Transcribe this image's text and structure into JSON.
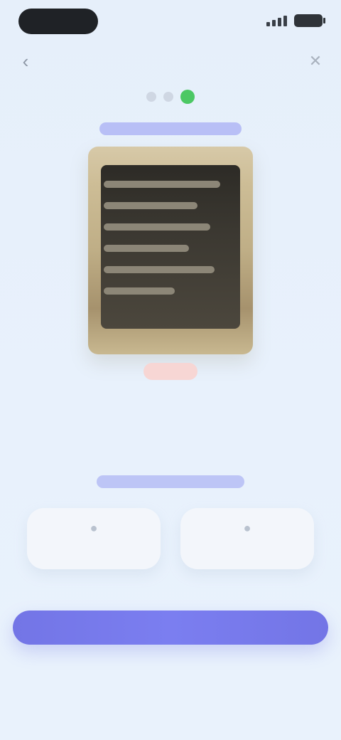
{
  "status_bar": {
    "pill": "",
    "signal_icon": "signal-icon",
    "battery_icon": "battery-icon"
  },
  "nav": {
    "back_icon": "chevron-left-icon",
    "title": "",
    "close_icon": "close-icon"
  },
  "progress": {
    "steps": 3,
    "done_step": 2
  },
  "receipt": {
    "label": "",
    "photo_alt": "receipt-photo",
    "retake_label": ""
  },
  "section": {
    "caption": "",
    "title": ""
  },
  "options": [
    {
      "icon": "camera-icon",
      "label": ""
    },
    {
      "icon": "gallery-icon",
      "label": ""
    }
  ],
  "actions": {
    "primary_label": "",
    "secondary_label": ""
  },
  "colors": {
    "accent": "#7375e6",
    "success": "#4cc864",
    "danger": "#e05a52",
    "background": "#e6effa"
  }
}
